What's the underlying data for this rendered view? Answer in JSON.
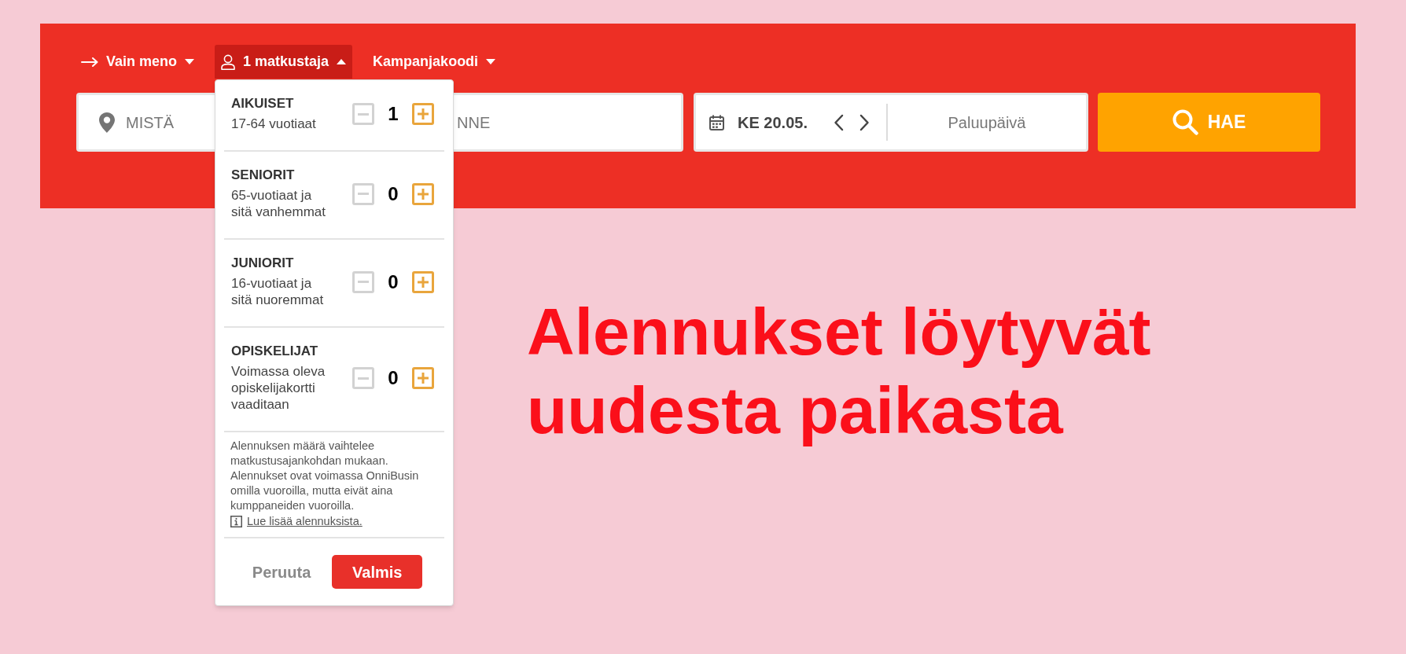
{
  "search_panel": {
    "trip_options": [
      {
        "kind": "trip_type",
        "label": "Vain meno",
        "expanded": false
      },
      {
        "kind": "passengers",
        "label": "1 matkustaja",
        "expanded": true
      },
      {
        "kind": "promo_code",
        "label": "Kampanjakoodi",
        "expanded": false
      }
    ],
    "from_field": {
      "placeholder": "MISTÄ"
    },
    "to_field": {
      "placeholder": "NNE"
    },
    "date_field": {
      "value": "KE 20.05.",
      "return_placeholder": "Paluupäivä"
    },
    "search_button": {
      "label": "HAE"
    }
  },
  "passenger_dropdown": {
    "groups": [
      {
        "title": "AIKUISET",
        "description": "17-64 vuotiaat",
        "count": "1",
        "decrease_disabled": true,
        "increase_disabled": false
      },
      {
        "title": "SENIORIT",
        "description": "65-vuotiaat ja sitä vanhemmat",
        "count": "0",
        "decrease_disabled": true,
        "increase_disabled": false
      },
      {
        "title": "JUNIORIT",
        "description": "16-vuotiaat ja sitä nuoremmat",
        "count": "0",
        "decrease_disabled": true,
        "increase_disabled": false
      },
      {
        "title": "OPISKELIJAT",
        "description": "Voimassa oleva opiskelijakortti vaaditaan",
        "count": "0",
        "decrease_disabled": true,
        "increase_disabled": false
      }
    ],
    "note": "Alennuksen määrä vaihtelee matkustusajankohdan mukaan. Alennukset ovat voimassa OnniBusin omilla vuoroilla, mutta eivät aina kumppaneiden vuoroilla.",
    "link": "Lue lisää alennuksista.",
    "cancel_button": "Peruuta",
    "confirm_button": "Valmis"
  },
  "headline": "Alennukset löytyvät uudesta paikasta"
}
